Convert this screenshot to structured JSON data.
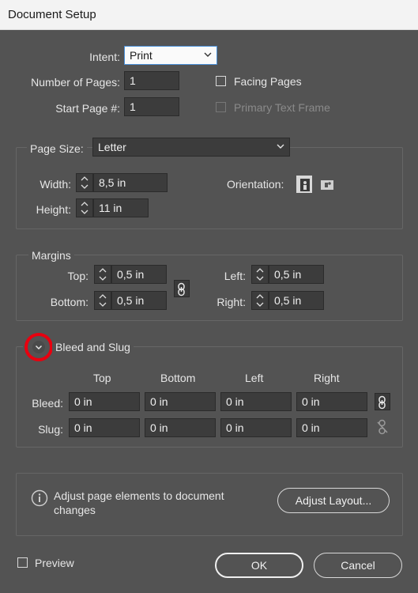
{
  "window": {
    "title": "Document Setup"
  },
  "general": {
    "intent_label": "Intent:",
    "intent_value": "Print",
    "pages_label": "Number of Pages:",
    "pages_value": "1",
    "start_label": "Start Page #:",
    "start_value": "1",
    "facing_label": "Facing Pages",
    "primary_label": "Primary Text Frame"
  },
  "page_size": {
    "label": "Page Size:",
    "value": "Letter",
    "width_label": "Width:",
    "width_value": "8,5 in",
    "height_label": "Height:",
    "height_value": "11 in",
    "orientation_label": "Orientation:"
  },
  "margins": {
    "title": "Margins",
    "top_label": "Top:",
    "top_value": "0,5 in",
    "bottom_label": "Bottom:",
    "bottom_value": "0,5 in",
    "left_label": "Left:",
    "left_value": "0,5 in",
    "right_label": "Right:",
    "right_value": "0,5 in"
  },
  "bleed_slug": {
    "title": "Bleed and Slug",
    "col_top": "Top",
    "col_bottom": "Bottom",
    "col_left": "Left",
    "col_right": "Right",
    "bleed_label": "Bleed:",
    "slug_label": "Slug:",
    "bleed": [
      "0 in",
      "0 in",
      "0 in",
      "0 in"
    ],
    "slug": [
      "0 in",
      "0 in",
      "0 in",
      "0 in"
    ]
  },
  "adjust": {
    "message": "Adjust page elements to document changes",
    "button": "Adjust Layout..."
  },
  "footer": {
    "preview_label": "Preview",
    "ok": "OK",
    "cancel": "Cancel"
  },
  "colors": {
    "background": "#535353",
    "field": "#3c3c3c",
    "highlight_ring": "#e8000f",
    "focus_border": "#4a90d9"
  },
  "icons": [
    "chevron-down-icon",
    "spinner-arrows-icon",
    "portrait-icon",
    "landscape-icon",
    "chain-link-icon",
    "broken-link-icon",
    "info-icon",
    "expand-chevron-icon"
  ]
}
